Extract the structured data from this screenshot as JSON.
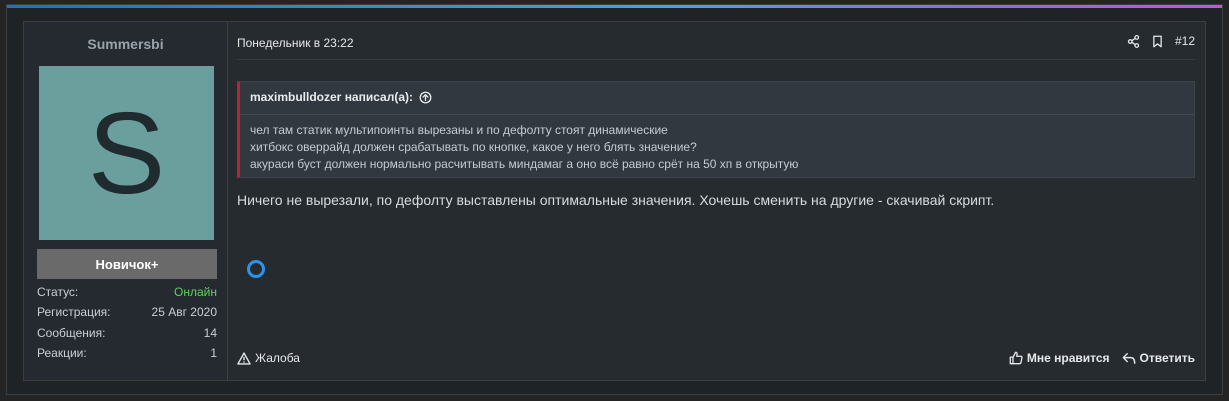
{
  "user": {
    "name": "Summersbi",
    "avatar_letter": "S",
    "avatar_color": "#6b9f9e",
    "rank": "Новичок+",
    "stats": [
      {
        "label": "Статус:",
        "value": "Онлайн"
      },
      {
        "label": "Регистрация:",
        "value": "25 Авг 2020"
      },
      {
        "label": "Сообщения:",
        "value": "14"
      },
      {
        "label": "Реакции:",
        "value": "1"
      }
    ]
  },
  "post": {
    "date": "Понедельник в 23:22",
    "number": "#12",
    "quote": {
      "author": "maximbulldozer написал(а):",
      "lines": [
        "чел там статик мультипоинты вырезаны и по дефолту стоят динамические",
        "хитбокс оверрайд должен срабатывать по кнопке, какое у него блять значение?",
        "акураси буст должен нормально расчитывать миндамаг а оно всё равно срёт на 50 хп в открытую"
      ]
    },
    "message": "Ничего не вырезали, по дефолту выставлены оптимальные значения. Хочешь сменить на другие - скачивай скрипт.",
    "report_label": "Жалоба",
    "like_label": "Мне нравится",
    "reply_label": "Ответить"
  },
  "colors": {
    "quote_accent": "#b5243a",
    "online": "#5ed15e",
    "spinner": "#2b93e8"
  },
  "icons": [
    "share-icon",
    "bookmark-icon",
    "arrow-up-circle-icon",
    "warning-icon",
    "thumbs-up-icon",
    "reply-icon"
  ]
}
